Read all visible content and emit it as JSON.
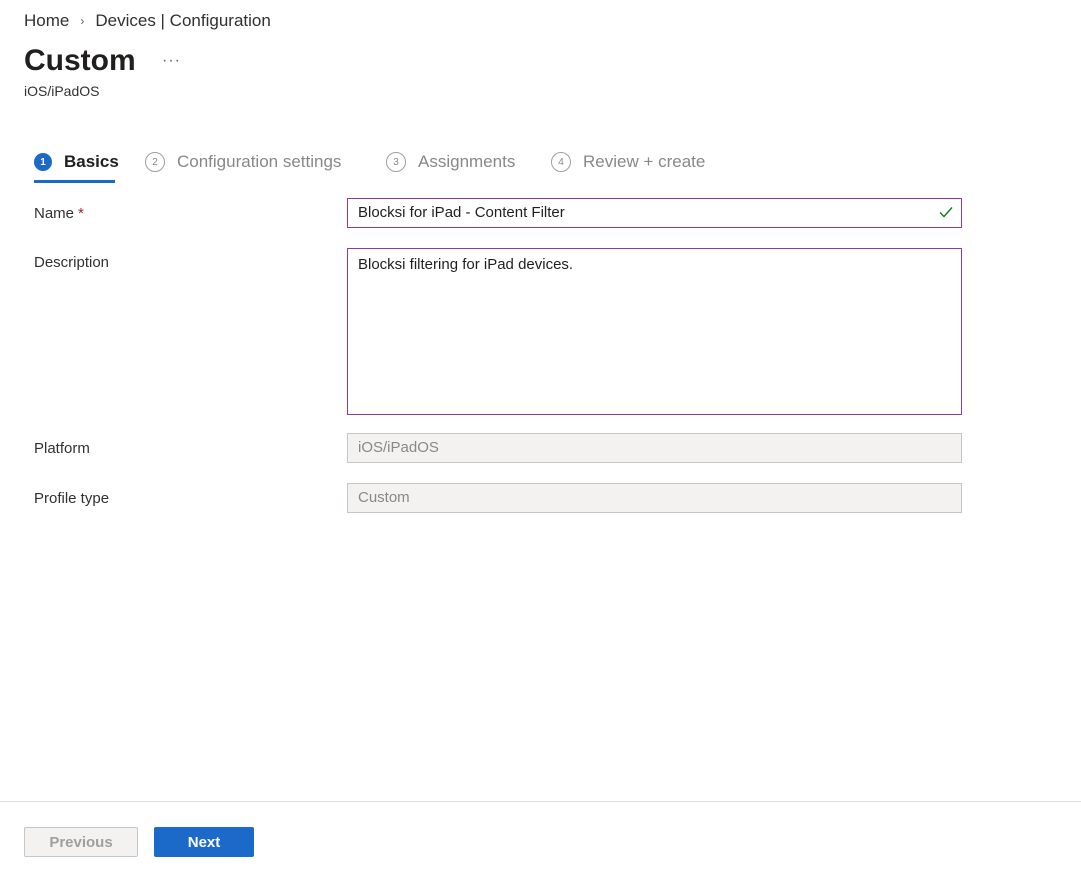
{
  "breadcrumb": {
    "home": "Home",
    "separator": "›",
    "current": "Devices | Configuration"
  },
  "header": {
    "title": "Custom",
    "more": "···",
    "subtitle": "iOS/iPadOS"
  },
  "steps": [
    {
      "num": "1",
      "label": "Basics",
      "active": true
    },
    {
      "num": "2",
      "label": "Configuration settings",
      "active": false
    },
    {
      "num": "3",
      "label": "Assignments",
      "active": false
    },
    {
      "num": "4",
      "label": "Review + create",
      "active": false
    }
  ],
  "form": {
    "name": {
      "label": "Name",
      "required_mark": "*",
      "value": "Blocksi for iPad - Content Filter",
      "icon": "checkmark-icon"
    },
    "description": {
      "label": "Description",
      "value": "Blocksi filtering for iPad devices."
    },
    "platform": {
      "label": "Platform",
      "value": "iOS/iPadOS"
    },
    "profile_type": {
      "label": "Profile type",
      "value": "Custom"
    }
  },
  "footer": {
    "previous_label": "Previous",
    "next_label": "Next"
  },
  "colors": {
    "accent": "#1b6ac9",
    "focus_border": "#8c3aa8",
    "required": "#a4262c",
    "valid": "#107c10"
  }
}
